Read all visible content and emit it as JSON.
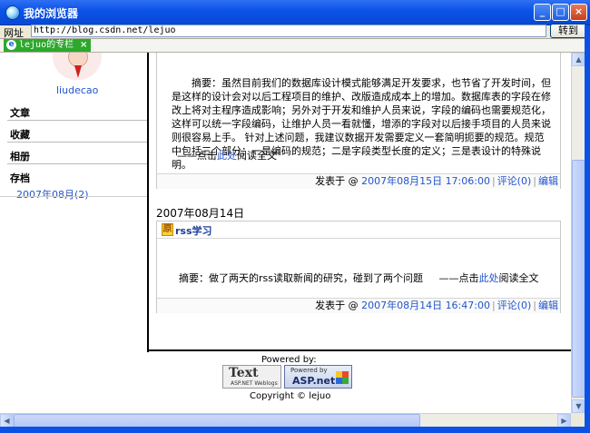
{
  "window": {
    "title": "我的浏览器"
  },
  "address": {
    "label": "网址",
    "url": "http://blog.csdn.net/lejuo",
    "go_label": "转到"
  },
  "tab": {
    "label": "lejuo的专栏",
    "close": "×"
  },
  "sidebar": {
    "username": "liudecao",
    "headings": [
      "文章",
      "收藏",
      "相册",
      "存档"
    ],
    "archive_link": "2007年08月(2)"
  },
  "post1": {
    "abstract": "摘要：虽然目前我们的数据库设计模式能够满足开发要求，也节省了开发时间，但是这样的设计会对以后工程项目的维护、改版造成成本上的增加。数据库表的字段在修改上将对主程序造成影响；另外对于开发和维护人员来说，字段的编码也需要规范化，这样可以统一字段编码，让维护人员一看就懂，增添的字段对以后接手项目的人员来说则很容易上手。 针对上述问题，我建议数据开发需要定义一套简明扼要的规范。规范中包括三个部分：一是编码的规范；二是字段类型长度的定义；三是表设计的特殊说明。",
    "readmore_prefix": "——点击",
    "readmore_link": "此处",
    "readmore_suffix": "阅读全文",
    "footer": {
      "prefix": "发表于 @",
      "datetime": "2007年08月15日 17:06:00",
      "comments": "评论(0)",
      "edit": "编辑"
    }
  },
  "date_heading": "2007年08月14日",
  "post2": {
    "title": "rss学习",
    "abstract": "摘要：做了两天的rss读取新闻的研究，碰到了两个问题",
    "readmore_prefix": "——点击",
    "readmore_link": "此处",
    "readmore_suffix": "阅读全文",
    "footer": {
      "prefix": "发表于 @",
      "datetime": "2007年08月14日 16:47:00",
      "comments": "评论(0)",
      "edit": "编辑"
    }
  },
  "powered": {
    "label": "Powered by:",
    "badge1_big": "Text",
    "badge1_small": "ASP.NET Weblogs",
    "badge2_small": "Powered by",
    "badge2_big": "ASP.net",
    "copyright": "Copyright © lejuo"
  },
  "icons": {
    "app": "ie-globe-icon",
    "minimize": "minimize-icon",
    "maximize": "maximize-icon",
    "close": "close-icon"
  }
}
